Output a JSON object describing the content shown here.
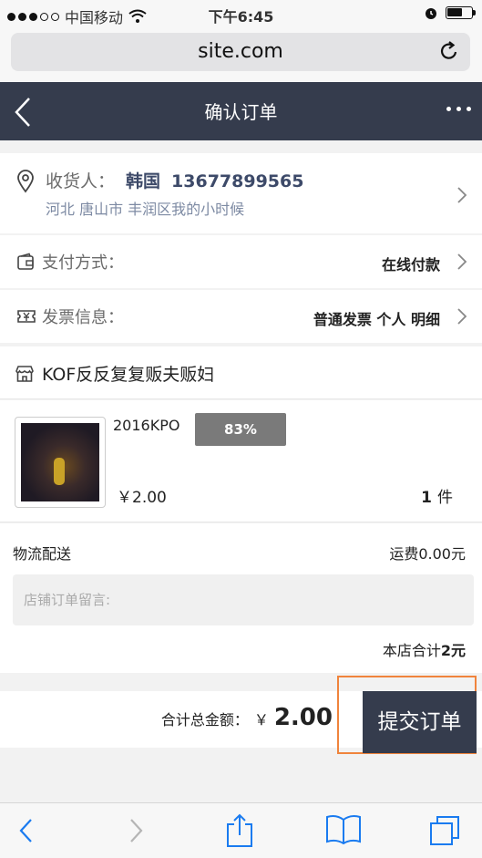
{
  "status_bar": {
    "carrier": "中国移动",
    "time": "下午6:45",
    "battery_level": 0.65
  },
  "browser": {
    "url": "site.com"
  },
  "nav": {
    "title": "确认订单"
  },
  "address": {
    "label": "收货人：",
    "name": "韩国",
    "phone": "13677899565",
    "detail": "河北 唐山市 丰润区我的小时候"
  },
  "payment": {
    "label": "支付方式：",
    "value": "在线付款"
  },
  "invoice": {
    "label": "发票信息：",
    "value": "普通发票 个人 明细"
  },
  "shop": {
    "name": "KOF反反复复贩夫贩妇"
  },
  "product": {
    "name": "2016KPO",
    "badge": "83%",
    "price": "￥2.00",
    "qty": "1",
    "qty_unit": "件"
  },
  "shipping": {
    "label": "物流配送",
    "fee": "运费0.00元",
    "note_placeholder": "店铺订单留言:",
    "subtotal_label": "本店合计",
    "subtotal_value": "2元"
  },
  "footer": {
    "total_label": "合计总金额：",
    "currency": "￥",
    "total": "2.00",
    "submit_label": "提交订单"
  },
  "colors": {
    "nav_bg": "#353c4d",
    "accent_blue": "#1a7bf0",
    "highlight_border": "#f0843c"
  },
  "icons": {
    "signal": "signal-dots-icon",
    "wifi": "wifi-icon",
    "alarm": "alarm-icon",
    "battery": "battery-icon",
    "reload": "reload-icon",
    "back": "back-arrow-icon",
    "more": "more-dots-icon",
    "location": "location-pin-icon",
    "wallet": "wallet-icon",
    "invoice": "invoice-yen-icon",
    "store": "store-icon",
    "chevron": "chevron-right-icon",
    "safari_back": "safari-back-icon",
    "safari_forward": "safari-forward-icon",
    "share": "share-icon",
    "bookmarks": "bookmarks-icon",
    "tabs": "tabs-icon"
  }
}
